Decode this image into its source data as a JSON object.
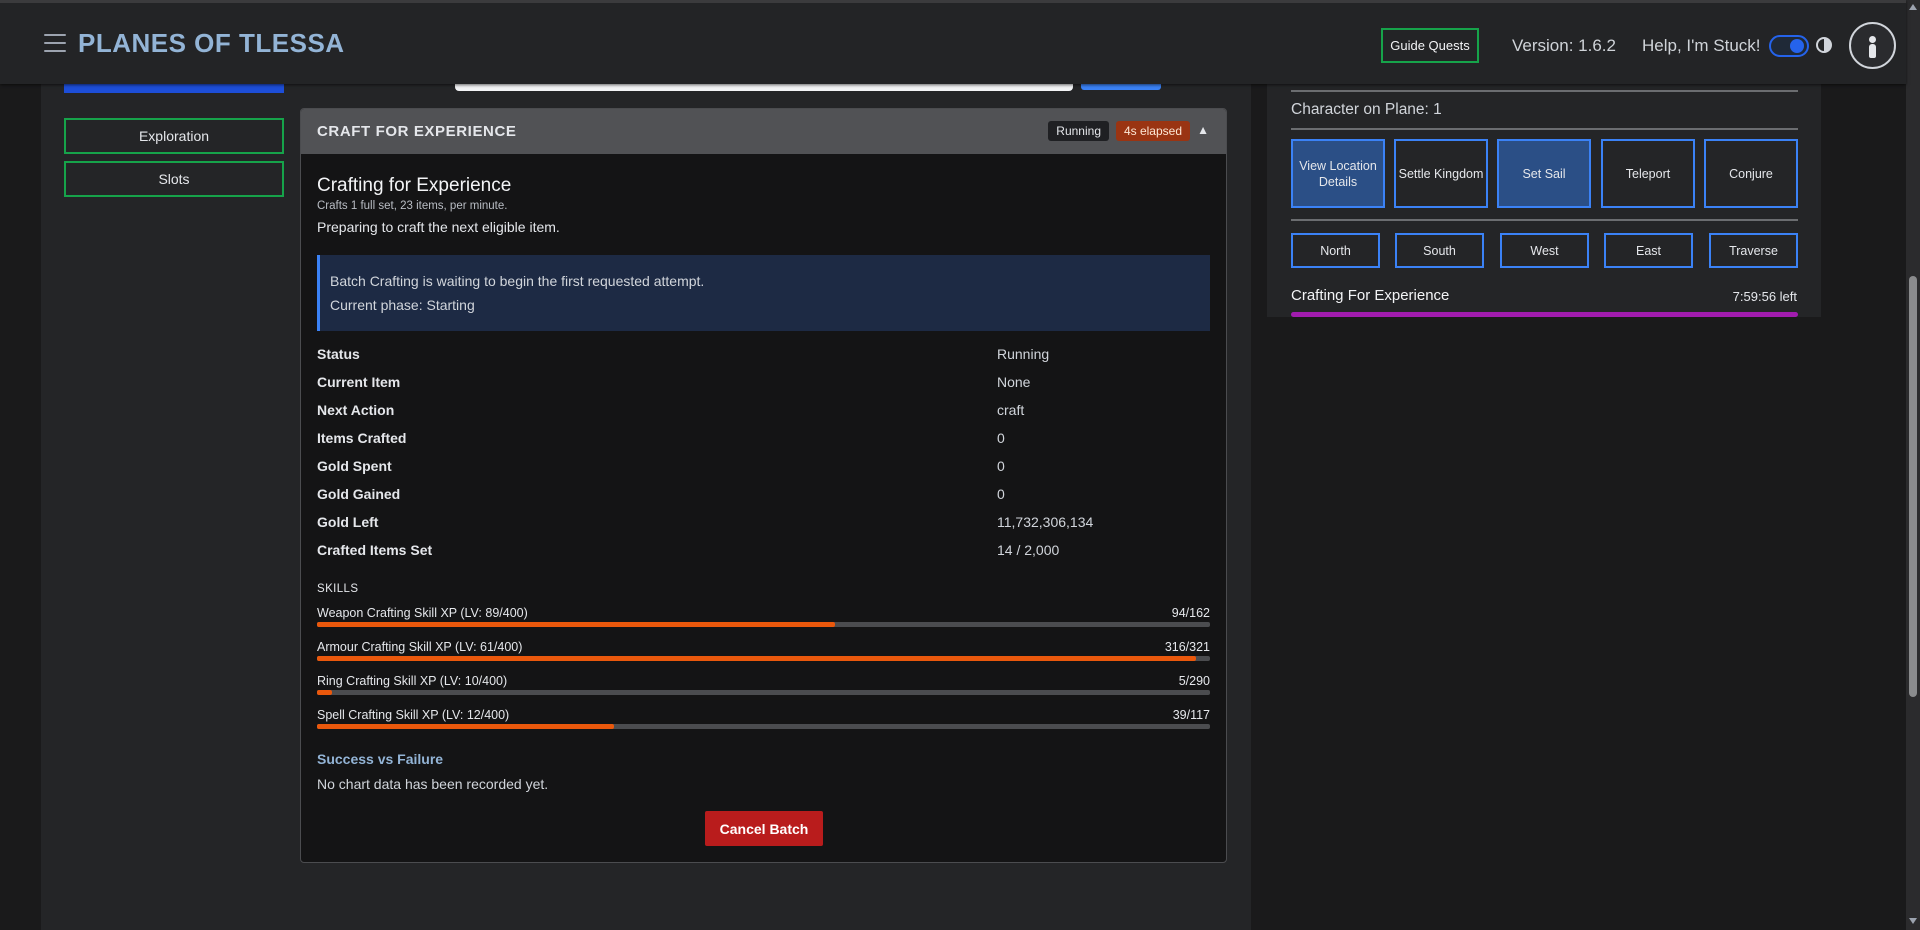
{
  "header": {
    "brand": "PLANES OF TLESSA",
    "guide_quests": "Guide Quests",
    "version": "Version: 1.6.2",
    "help": "Help, I'm Stuck!"
  },
  "sidebar": {
    "items": [
      {
        "label": "Exploration"
      },
      {
        "label": "Slots"
      }
    ]
  },
  "card": {
    "header_title": "CRAFT FOR EXPERIENCE",
    "status_badge": "Running",
    "elapsed_badge": "4s elapsed",
    "collapse_glyph": "▲",
    "title": "Crafting for Experience",
    "subtitle": "Crafts 1 full set, 23 items, per minute.",
    "preparing": "Preparing to craft the next eligible item.",
    "info_line1": "Batch Crafting is waiting to begin the first requested attempt.",
    "info_line2": "Current phase: Starting",
    "stats": [
      {
        "label": "Status",
        "value": "Running"
      },
      {
        "label": "Current Item",
        "value": "None"
      },
      {
        "label": "Next Action",
        "value": "craft"
      },
      {
        "label": "Items Crafted",
        "value": "0"
      },
      {
        "label": "Gold Spent",
        "value": "0"
      },
      {
        "label": "Gold Gained",
        "value": "0"
      },
      {
        "label": "Gold Left",
        "value": "11,732,306,134"
      },
      {
        "label": "Crafted Items Set",
        "value": "14 / 2,000"
      }
    ],
    "skills_heading": "SKILLS",
    "skills": [
      {
        "label": "Weapon Crafting Skill XP (LV: 89/400)",
        "value": "94/162",
        "progress": 0.58
      },
      {
        "label": "Armour Crafting Skill XP (LV: 61/400)",
        "value": "316/321",
        "progress": 0.984
      },
      {
        "label": "Ring Crafting Skill XP (LV: 10/400)",
        "value": "5/290",
        "progress": 0.017
      },
      {
        "label": "Spell Crafting Skill XP (LV: 12/400)",
        "value": "39/117",
        "progress": 0.333
      }
    ],
    "success_heading": "Success vs Failure",
    "no_chart": "No chart data has been recorded yet.",
    "cancel_button": "Cancel Batch"
  },
  "right_panel": {
    "plane": "Character on Plane: 1",
    "actions": [
      {
        "label": "View Location Details",
        "filled": true
      },
      {
        "label": "Settle Kingdom",
        "filled": false
      },
      {
        "label": "Set Sail",
        "filled": true
      },
      {
        "label": "Teleport",
        "filled": false
      },
      {
        "label": "Conjure",
        "filled": false
      }
    ],
    "directions": [
      "North",
      "South",
      "West",
      "East",
      "Traverse"
    ],
    "timer_label": "Crafting For Experience",
    "timer_left": "7:59:56 left"
  },
  "colors": {
    "accent_blue": "#3b82f6",
    "accent_green": "#16a34a",
    "progress_orange": "#ea580c",
    "timer_magenta": "#a21caf",
    "danger_red": "#b91c1c"
  },
  "icons": {
    "menu": "hamburger-icon",
    "theme": "contrast-icon",
    "profile": "user-avatar-icon"
  }
}
